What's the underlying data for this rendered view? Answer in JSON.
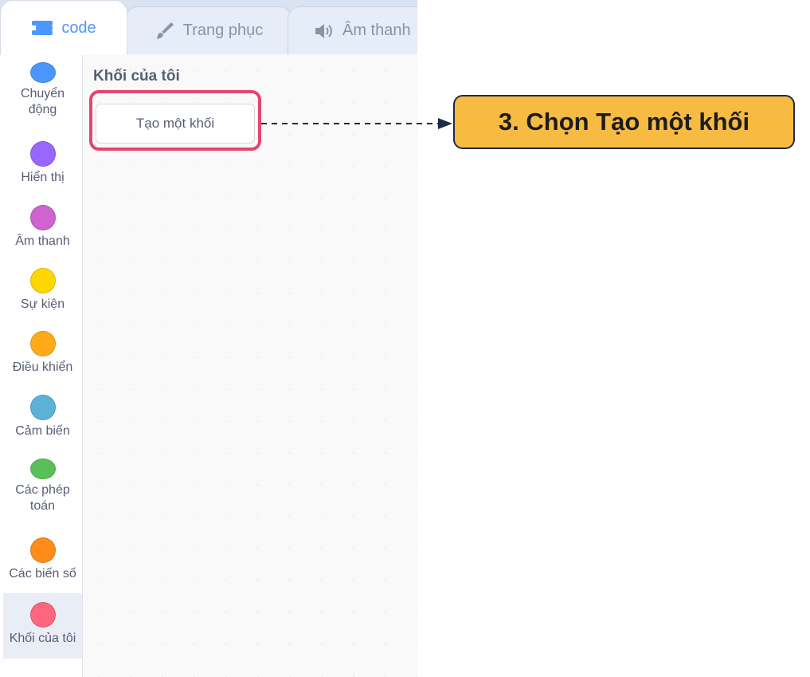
{
  "tabs": [
    {
      "label": "code",
      "icon": "code-blocks-icon",
      "active": true
    },
    {
      "label": "Trang phục",
      "icon": "paintbrush-icon",
      "active": false
    },
    {
      "label": "Âm thanh",
      "icon": "speaker-icon",
      "active": false
    }
  ],
  "categories": [
    {
      "label": "Chuyển động",
      "color": "#4C97FF"
    },
    {
      "label": "Hiển thị",
      "color": "#9966FF"
    },
    {
      "label": "Âm thanh",
      "color": "#CF63CF"
    },
    {
      "label": "Sự kiện",
      "color": "#FFD500"
    },
    {
      "label": "Điều khiển",
      "color": "#FFAB19"
    },
    {
      "label": "Cảm biến",
      "color": "#5CB1D6"
    },
    {
      "label": "Các phép toán",
      "color": "#59C059"
    },
    {
      "label": "Các biến số",
      "color": "#FF8C1A"
    },
    {
      "label": "Khối của tôi",
      "color": "#FF6680",
      "selected": true
    }
  ],
  "flyout": {
    "title": "Khối của tôi",
    "make_block_label": "Tạo một khối"
  },
  "annotation": {
    "text": "3. Chọn Tạo một khối",
    "highlight_color": "#E5466B",
    "callout_color": "#F8BB42"
  }
}
